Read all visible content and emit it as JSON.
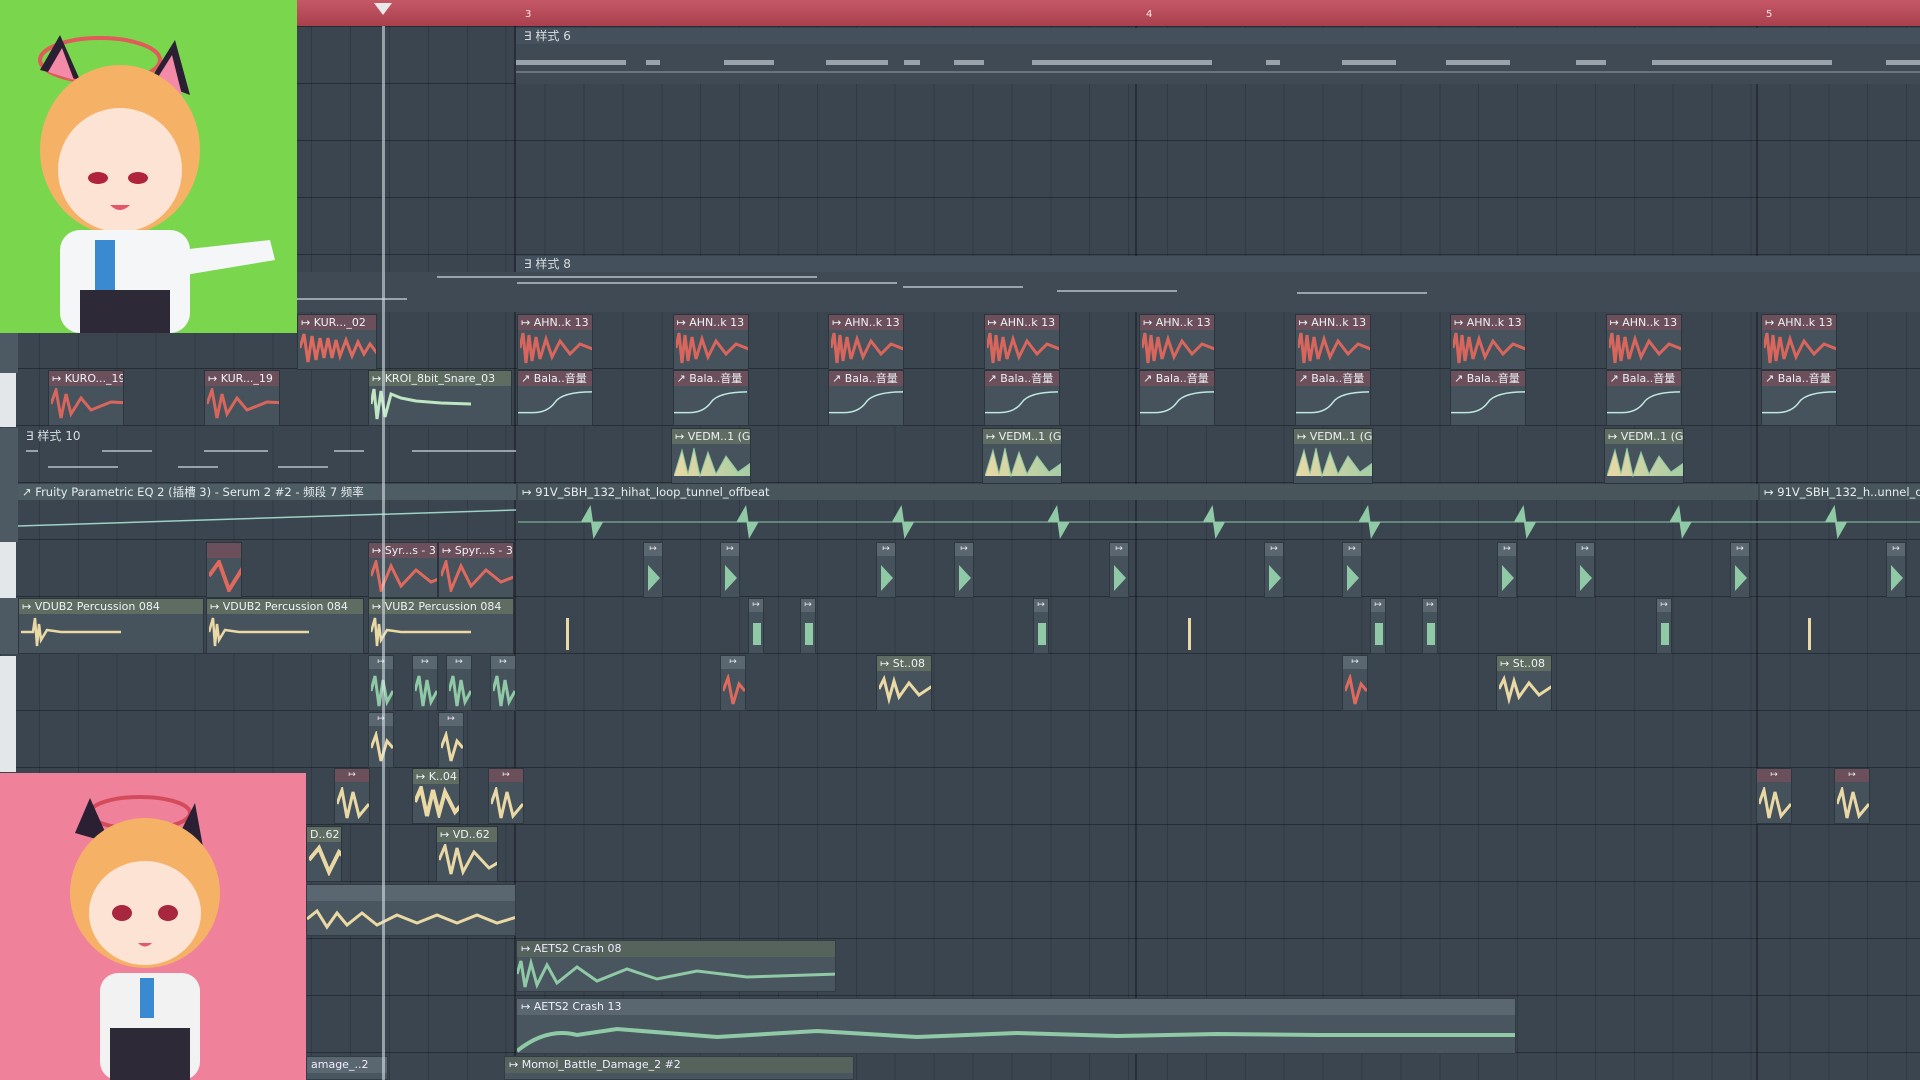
{
  "ruler": {
    "bar_3": "3",
    "bar_4": "4",
    "bar_5": "5"
  },
  "patterns": {
    "p6": "∃ 样式 6",
    "p8": "∃ 样式 8",
    "p10": "∃ 样式 10"
  },
  "clips": {
    "kur_02": "↦ KUR..._02",
    "kuro_19a": "↦ KURO..._19",
    "kur_19b": "↦ KUR..._19",
    "kroi_snare": "↦ KROI_8bit_Snare_03",
    "ahn": "↦ AHN..k 13",
    "bala": "↗ Bala..音量",
    "vedm": "↦ VEDM..1 (G)",
    "eq_auto": "↗ Fruity Parametric EQ 2 (插槽 3) - Serum 2 #2 - 频段 7 频率",
    "hihat_loop": "↦ 91V_SBH_132_hihat_loop_tunnel_offbeat",
    "hihat_loop_2": "↦ 91V_SBH_132_h..unnel_o",
    "syr_a": "↦ Syr...s - 3",
    "syr_b": "↦ Spyr...s - 3",
    "vdub_a": "↦ VDUB2 Percussion 084",
    "vdub_b": "↦ VDUB2 Percussion 084",
    "vdub_c": "↦ VUB2 Percussion 084",
    "st_08": "↦ St..08",
    "k_04": "↦ K..04",
    "d_62": "D..62",
    "vd_62": "↦ VD..62",
    "crash_08": "↦ AETS2 Crash 08",
    "crash_13": "↦ AETS2 Crash 13",
    "damage_a": "amage_..2",
    "damage_b": "↦ Momoi_Battle_Damage_2 #2"
  },
  "colors": {
    "ruler": "#c55866",
    "grid": "#3a454f",
    "clip_red": "#d9665d",
    "clip_green": "#8fc9a5",
    "clip_cream": "#ead9a4",
    "avatar_top_bg": "#7ad64d",
    "avatar_bottom_bg": "#f0819b"
  }
}
